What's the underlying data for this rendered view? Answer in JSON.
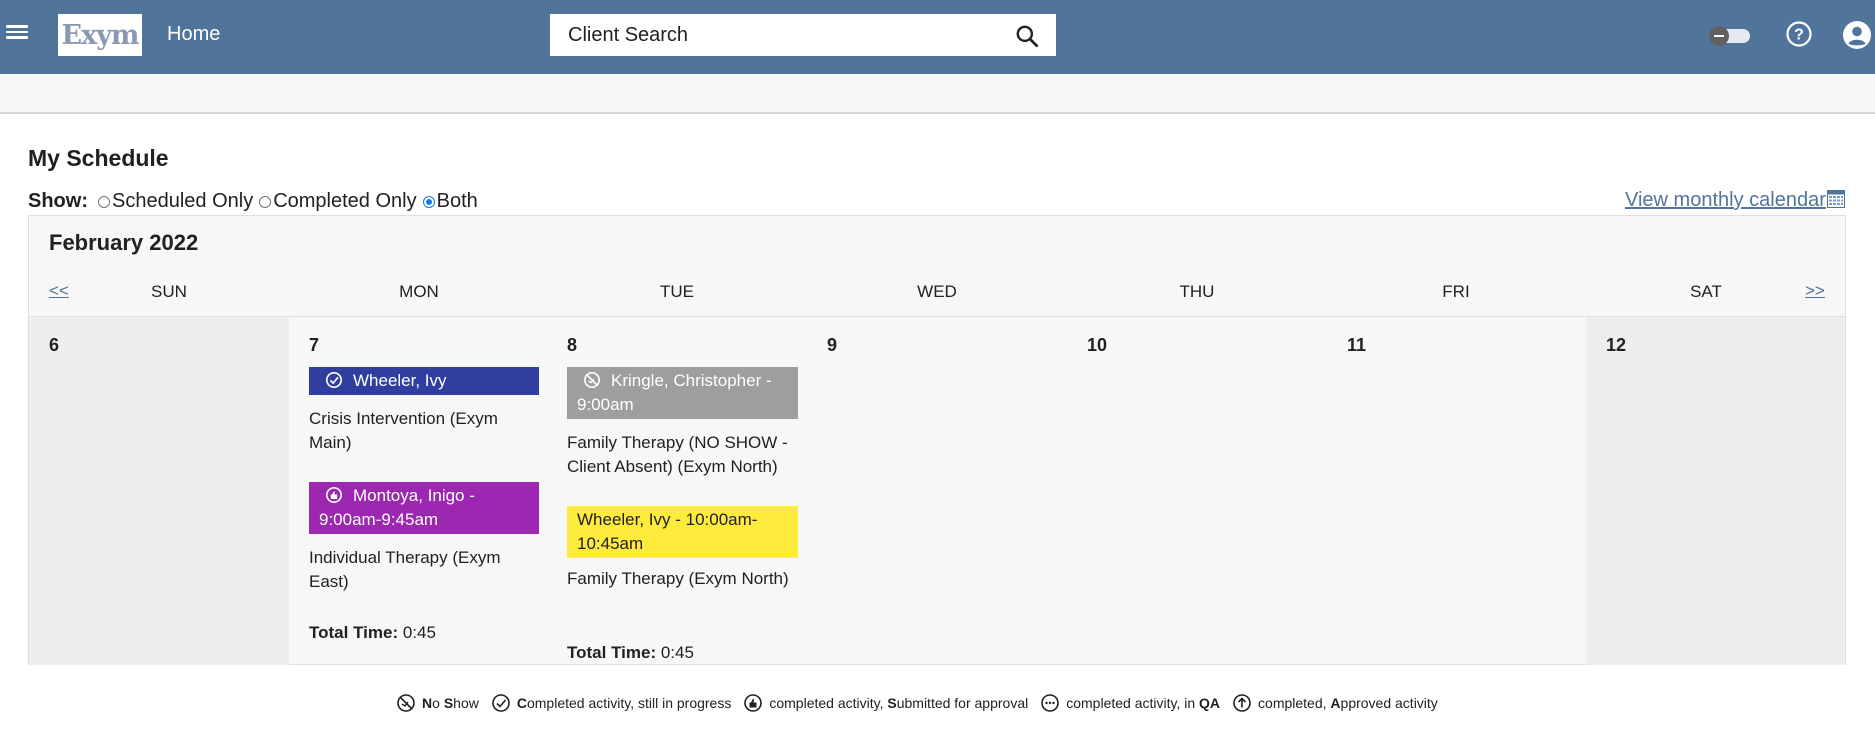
{
  "header": {
    "logo_text": "Exym",
    "home_label": "Home",
    "search_placeholder": "Client Search"
  },
  "page": {
    "title": "My Schedule",
    "show_label": "Show:",
    "options": [
      {
        "label": "Scheduled Only",
        "checked": false
      },
      {
        "label": "Completed Only",
        "checked": false
      },
      {
        "label": "Both",
        "checked": true
      }
    ],
    "monthly_link": "View monthly calendar"
  },
  "calendar": {
    "month": "February 2022",
    "prev": "<<",
    "next": ">>",
    "weekdays": [
      "SUN",
      "MON",
      "TUE",
      "WED",
      "THU",
      "FRI",
      "SAT"
    ],
    "days": [
      "6",
      "7",
      "8",
      "9",
      "10",
      "11",
      "12"
    ],
    "mon": {
      "event1": {
        "head": "Wheeler, Ivy",
        "desc": "Crisis Intervention (Exym Main)",
        "color": "#303f9f"
      },
      "event2": {
        "head": "Montoya, Inigo - 9:00am-9:45am",
        "desc": "Individual Therapy (Exym East)",
        "color": "#9c27b0"
      },
      "total_label": "Total Time:",
      "total_value": "0:45"
    },
    "tue": {
      "event1": {
        "head": "Kringle, Christopher - 9:00am",
        "desc": "Family Therapy (NO SHOW - Client Absent) (Exym North)",
        "color": "#9e9e9e"
      },
      "event2": {
        "head": "Wheeler, Ivy - 10:00am-10:45am",
        "desc": "Family Therapy (Exym North)",
        "color": "#ffeb3b"
      },
      "total_label": "Total Time:",
      "total_value": "0:45"
    }
  },
  "legend": {
    "no_show": {
      "b1": "N",
      "t1": "o ",
      "b2": "S",
      "t2": "how"
    },
    "completed": {
      "b1": "C",
      "t1": "ompleted activity, still in progress"
    },
    "submitted": {
      "t0": "completed activity, ",
      "b1": "S",
      "t1": "ubmitted for approval"
    },
    "qa": {
      "t0": "completed activity, in ",
      "b1": "QA"
    },
    "approved": {
      "t0": "completed, ",
      "b1": "A",
      "t1": "pproved activity"
    }
  },
  "colors": {
    "header_bg": "#50749a",
    "link": "#50749a",
    "weekend_bg": "#eeeeee"
  }
}
